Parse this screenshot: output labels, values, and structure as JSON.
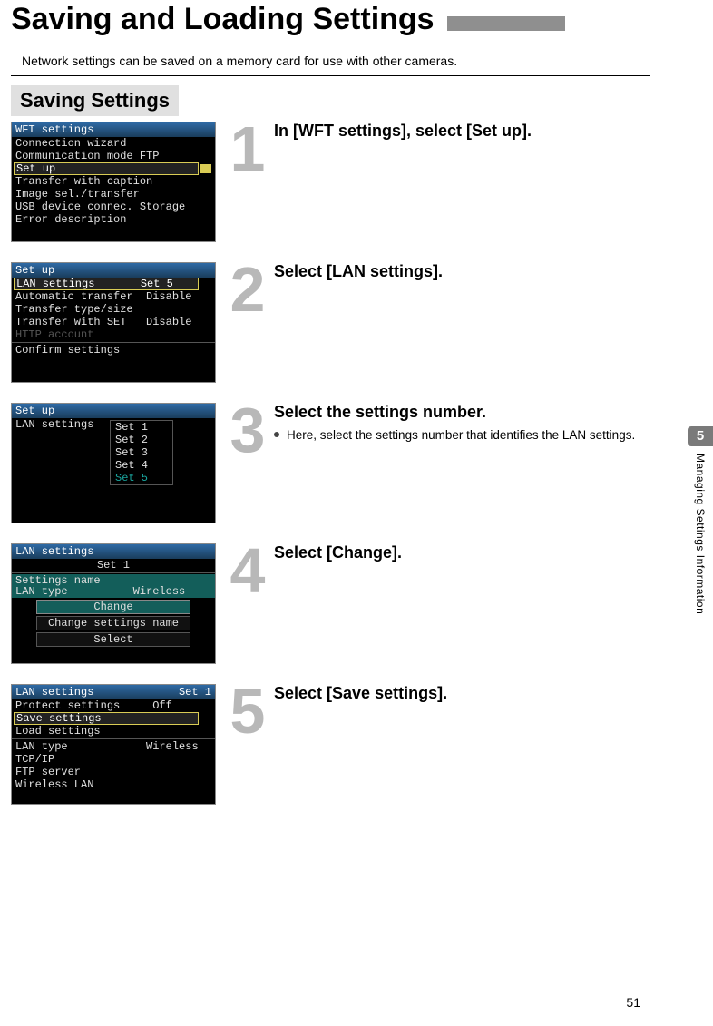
{
  "title": "Saving and Loading Settings",
  "intro": "Network settings can be saved on a memory card for use with other cameras.",
  "section_heading": "Saving Settings",
  "side_tab": {
    "num": "5",
    "label": "Managing Settings Information"
  },
  "page_number": "51",
  "steps": [
    {
      "num": "1",
      "title": "In [WFT settings], select [Set up]."
    },
    {
      "num": "2",
      "title": "Select [LAN settings]."
    },
    {
      "num": "3",
      "title": "Select the settings number.",
      "bullet": "Here, select the settings number that identifies the LAN settings."
    },
    {
      "num": "4",
      "title": "Select [Change]."
    },
    {
      "num": "5",
      "title": "Select [Save settings]."
    }
  ],
  "shots": {
    "s1": {
      "header": "WFT settings",
      "rows": [
        "Connection wizard",
        "Communication mode FTP",
        "Set up",
        "Transfer with caption",
        "Image sel./transfer",
        "USB device connec. Storage",
        "Error description"
      ]
    },
    "s2": {
      "header": "Set up",
      "rows": [
        {
          "l": "LAN settings",
          "r": "Set 5",
          "sel": true
        },
        {
          "l": "Automatic transfer",
          "r": "Disable"
        },
        {
          "l": "Transfer type/size",
          "r": ""
        },
        {
          "l": "Transfer with SET",
          "r": "Disable"
        },
        {
          "l": "HTTP account",
          "r": "",
          "disabled": true
        },
        {
          "l": "Confirm settings",
          "r": ""
        }
      ]
    },
    "s3": {
      "header": "Set up",
      "row": {
        "l": "LAN settings",
        "r": "▶Set 1"
      },
      "submenu": [
        "Set 1",
        "Set 2",
        "Set 3",
        "Set 4",
        "Set 5"
      ]
    },
    "s4": {
      "header": "LAN settings",
      "subheader": "Set 1",
      "info": [
        {
          "l": "Settings name",
          "r": ""
        },
        {
          "l": "LAN type",
          "r": "Wireless"
        }
      ],
      "buttons": [
        "Change",
        "Change settings name",
        "Select"
      ]
    },
    "s5": {
      "header_l": "LAN settings",
      "header_r": "Set 1",
      "rows": [
        {
          "l": "Protect settings",
          "r": "Off"
        },
        {
          "l": "Save settings",
          "r": "",
          "sel": true
        },
        {
          "l": "Load settings",
          "r": ""
        },
        {
          "l": "LAN type",
          "r": "Wireless"
        },
        {
          "l": "TCP/IP",
          "r": ""
        },
        {
          "l": "FTP server",
          "r": ""
        },
        {
          "l": "Wireless LAN",
          "r": ""
        }
      ]
    }
  }
}
